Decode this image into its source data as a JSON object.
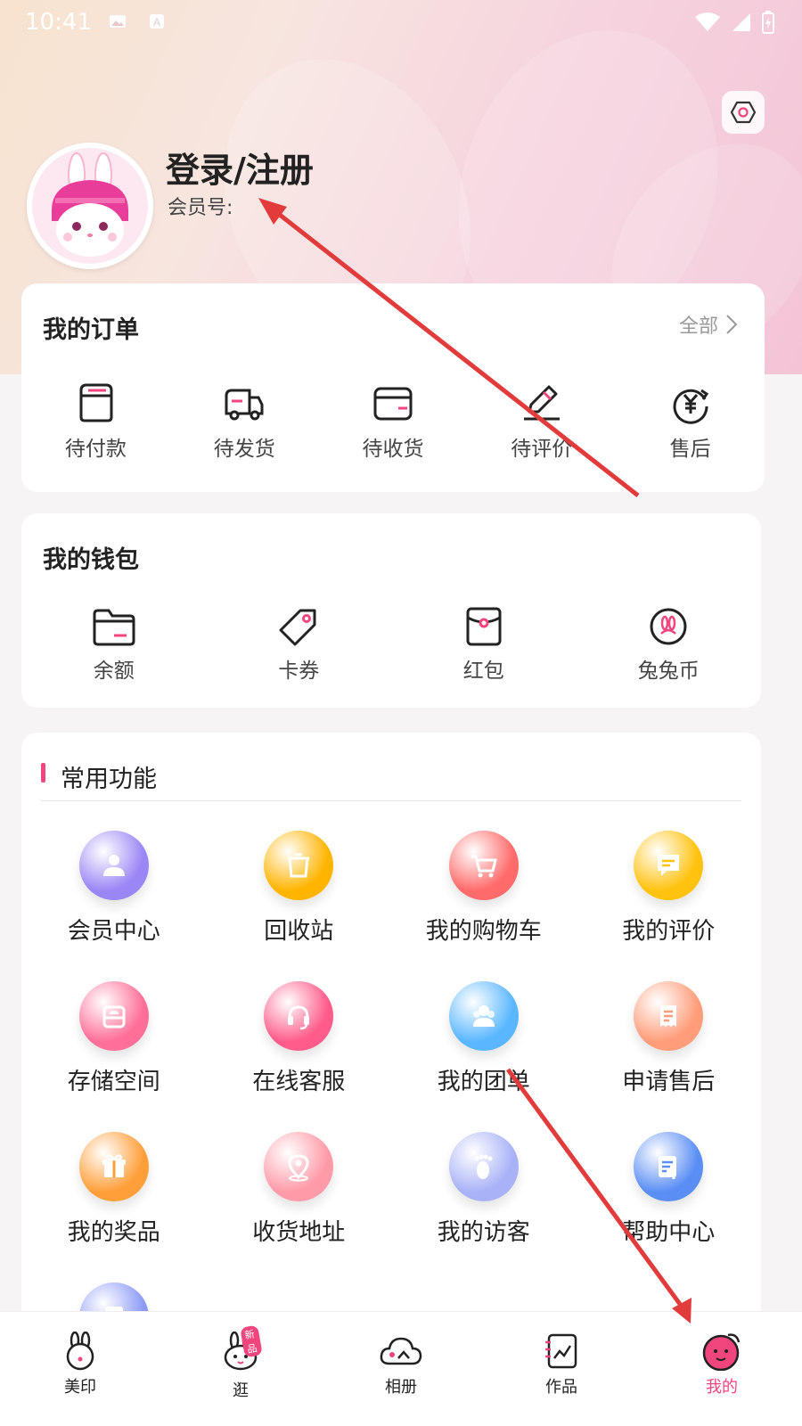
{
  "status_bar": {
    "time": "10:41"
  },
  "profile": {
    "title": "登录/注册",
    "member_label": "会员号:"
  },
  "orders": {
    "title": "我的订单",
    "all_label": "全部",
    "items": [
      "待付款",
      "待发货",
      "待收货",
      "待评价",
      "售后"
    ]
  },
  "wallet": {
    "title": "我的钱包",
    "items": [
      "余额",
      "卡券",
      "红包",
      "兔兔币"
    ]
  },
  "functions": {
    "title": "常用功能",
    "items": [
      {
        "label": "会员中心",
        "icon": "user-icon",
        "color": "#9b86f5"
      },
      {
        "label": "回收站",
        "icon": "trash-icon",
        "color": "#ffb400"
      },
      {
        "label": "我的购物车",
        "icon": "cart-icon",
        "color": "#ff6a6a"
      },
      {
        "label": "我的评价",
        "icon": "comment-icon",
        "color": "#ffc20e"
      },
      {
        "label": "存储空间",
        "icon": "cloud-storage-icon",
        "color": "#ff6f98"
      },
      {
        "label": "在线客服",
        "icon": "headset-icon",
        "color": "#ff5c8a"
      },
      {
        "label": "我的团单",
        "icon": "group-icon",
        "color": "#5ab7ff"
      },
      {
        "label": "申请售后",
        "icon": "receipt-icon",
        "color": "#ff9d7a"
      },
      {
        "label": "我的奖品",
        "icon": "gift-icon",
        "color": "#ff9f3a"
      },
      {
        "label": "收货地址",
        "icon": "location-icon",
        "color": "#ff9aa8"
      },
      {
        "label": "我的访客",
        "icon": "footprint-icon",
        "color": "#a9b2f7"
      },
      {
        "label": "帮助中心",
        "icon": "help-doc-icon",
        "color": "#5b8ef5"
      },
      {
        "label": "",
        "icon": "doc-edit-icon",
        "color": "#8d9bf7"
      }
    ]
  },
  "tabbar": {
    "items": [
      {
        "label": "美印",
        "icon": "bunny-icon"
      },
      {
        "label": "逛",
        "icon": "bunny-face-icon",
        "badge": "新品"
      },
      {
        "label": "相册",
        "icon": "cloud-album-icon"
      },
      {
        "label": "作品",
        "icon": "works-icon"
      },
      {
        "label": "我的",
        "icon": "me-icon"
      }
    ],
    "active_index": 4
  },
  "colors": {
    "accent": "#f0457d",
    "arrow": "#e23b3b"
  }
}
